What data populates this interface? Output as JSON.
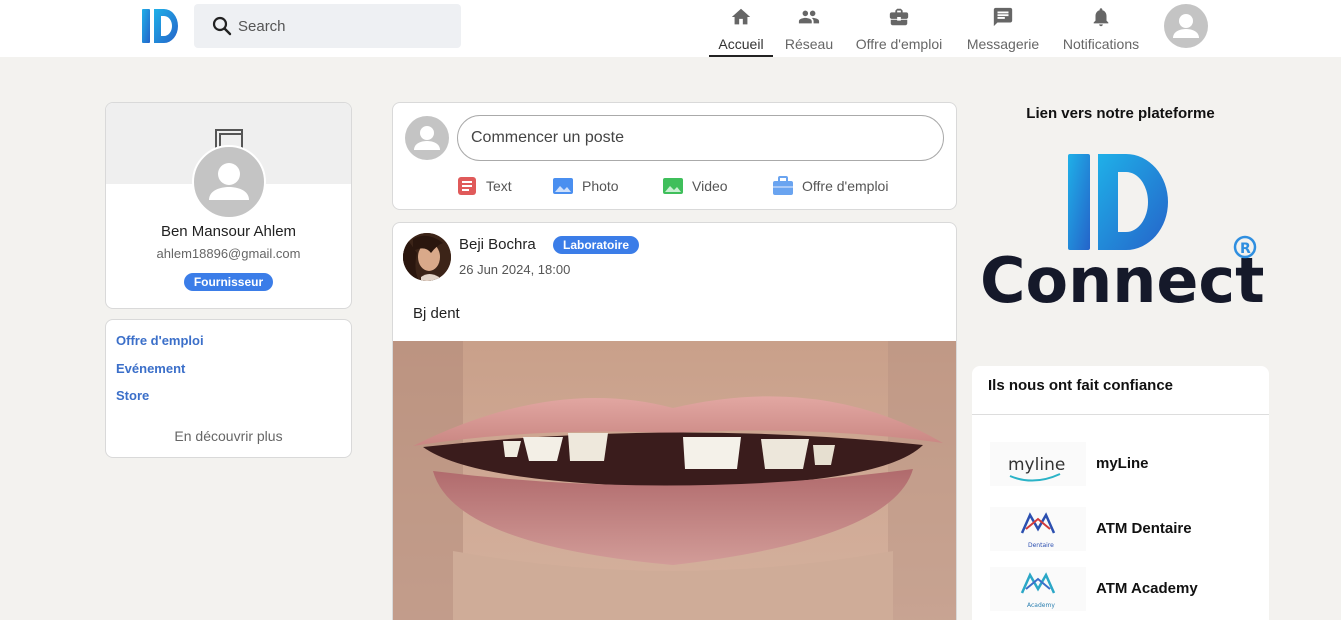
{
  "header": {
    "search_placeholder": "Search",
    "nav": [
      {
        "label": "Accueil",
        "icon": "home-icon",
        "active": true
      },
      {
        "label": "Réseau",
        "icon": "people-icon"
      },
      {
        "label": "Offre d'emploi",
        "icon": "briefcase-icon"
      },
      {
        "label": "Messagerie",
        "icon": "chat-icon"
      },
      {
        "label": "Notifications",
        "icon": "bell-icon"
      }
    ]
  },
  "profile": {
    "name": "Ben Mansour Ahlem",
    "email": "ahlem18896@gmail.com",
    "role": "Fournisseur"
  },
  "sidebar_links": {
    "items": [
      "Offre d'emploi",
      "Evénement",
      "Store"
    ],
    "more": "En découvrir plus"
  },
  "composer": {
    "placeholder": "Commencer un poste",
    "actions": [
      {
        "label": "Text",
        "icon": "text-doc-icon",
        "color": "#e05a5a"
      },
      {
        "label": "Photo",
        "icon": "photo-icon",
        "color": "#4a8ff0"
      },
      {
        "label": "Video",
        "icon": "video-icon",
        "color": "#3fbf5b"
      },
      {
        "label": "Offre d'emploi",
        "icon": "briefcase-icon",
        "color": "#6aa4f0"
      }
    ]
  },
  "post": {
    "author": "Beji Bochra",
    "badge": "Laboratoire",
    "date": "26 Jun 2024, 18:00",
    "text": "Bj dent"
  },
  "right": {
    "title": "Lien vers notre plateforme",
    "brand_word": "Connect",
    "trust_title": "Ils nous ont fait confiance",
    "partners": [
      {
        "name": "myLine",
        "logo_text": "myline"
      },
      {
        "name": "ATM Dentaire",
        "logo_text": "Dentaire"
      },
      {
        "name": "ATM Academy",
        "logo_text": "Academy"
      }
    ]
  },
  "colors": {
    "accent": "#3b7de8",
    "link": "#3b6fc9",
    "brand_blue": "#2f8fe0",
    "brand_dark": "#15192a"
  }
}
